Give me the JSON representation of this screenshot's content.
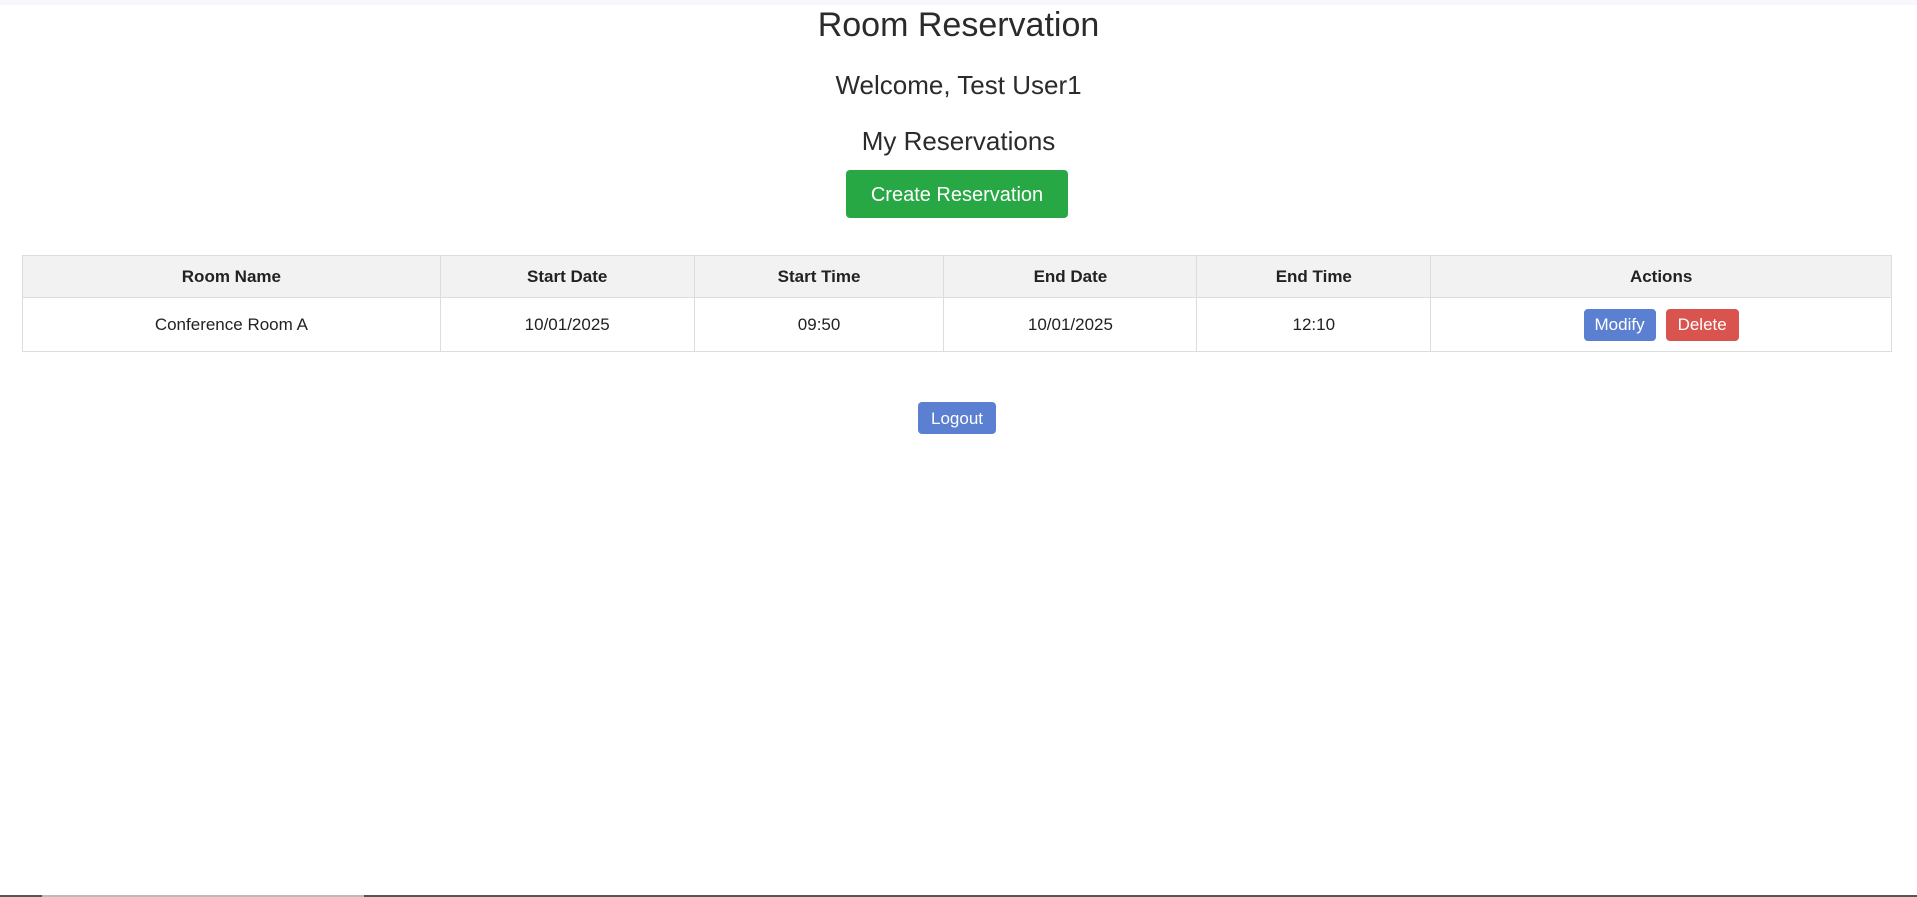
{
  "header": {
    "title": "Room Reservation",
    "welcome": "Welcome, Test User1",
    "section_title": "My Reservations"
  },
  "actions": {
    "create_label": "Create Reservation",
    "logout_label": "Logout"
  },
  "table": {
    "columns": [
      "Room Name",
      "Start Date",
      "Start Time",
      "End Date",
      "End Time",
      "Actions"
    ],
    "rows": [
      {
        "room_name": "Conference Room A",
        "start_date": "10/01/2025",
        "start_time": "09:50",
        "end_date": "10/01/2025",
        "end_time": "12:10",
        "modify_label": "Modify",
        "delete_label": "Delete"
      }
    ]
  },
  "colors": {
    "create_button": "#28a745",
    "modify_button": "#5b7fd1",
    "delete_button": "#d9534f",
    "logout_button": "#5b7fd1",
    "table_header_bg": "#f2f2f2"
  }
}
